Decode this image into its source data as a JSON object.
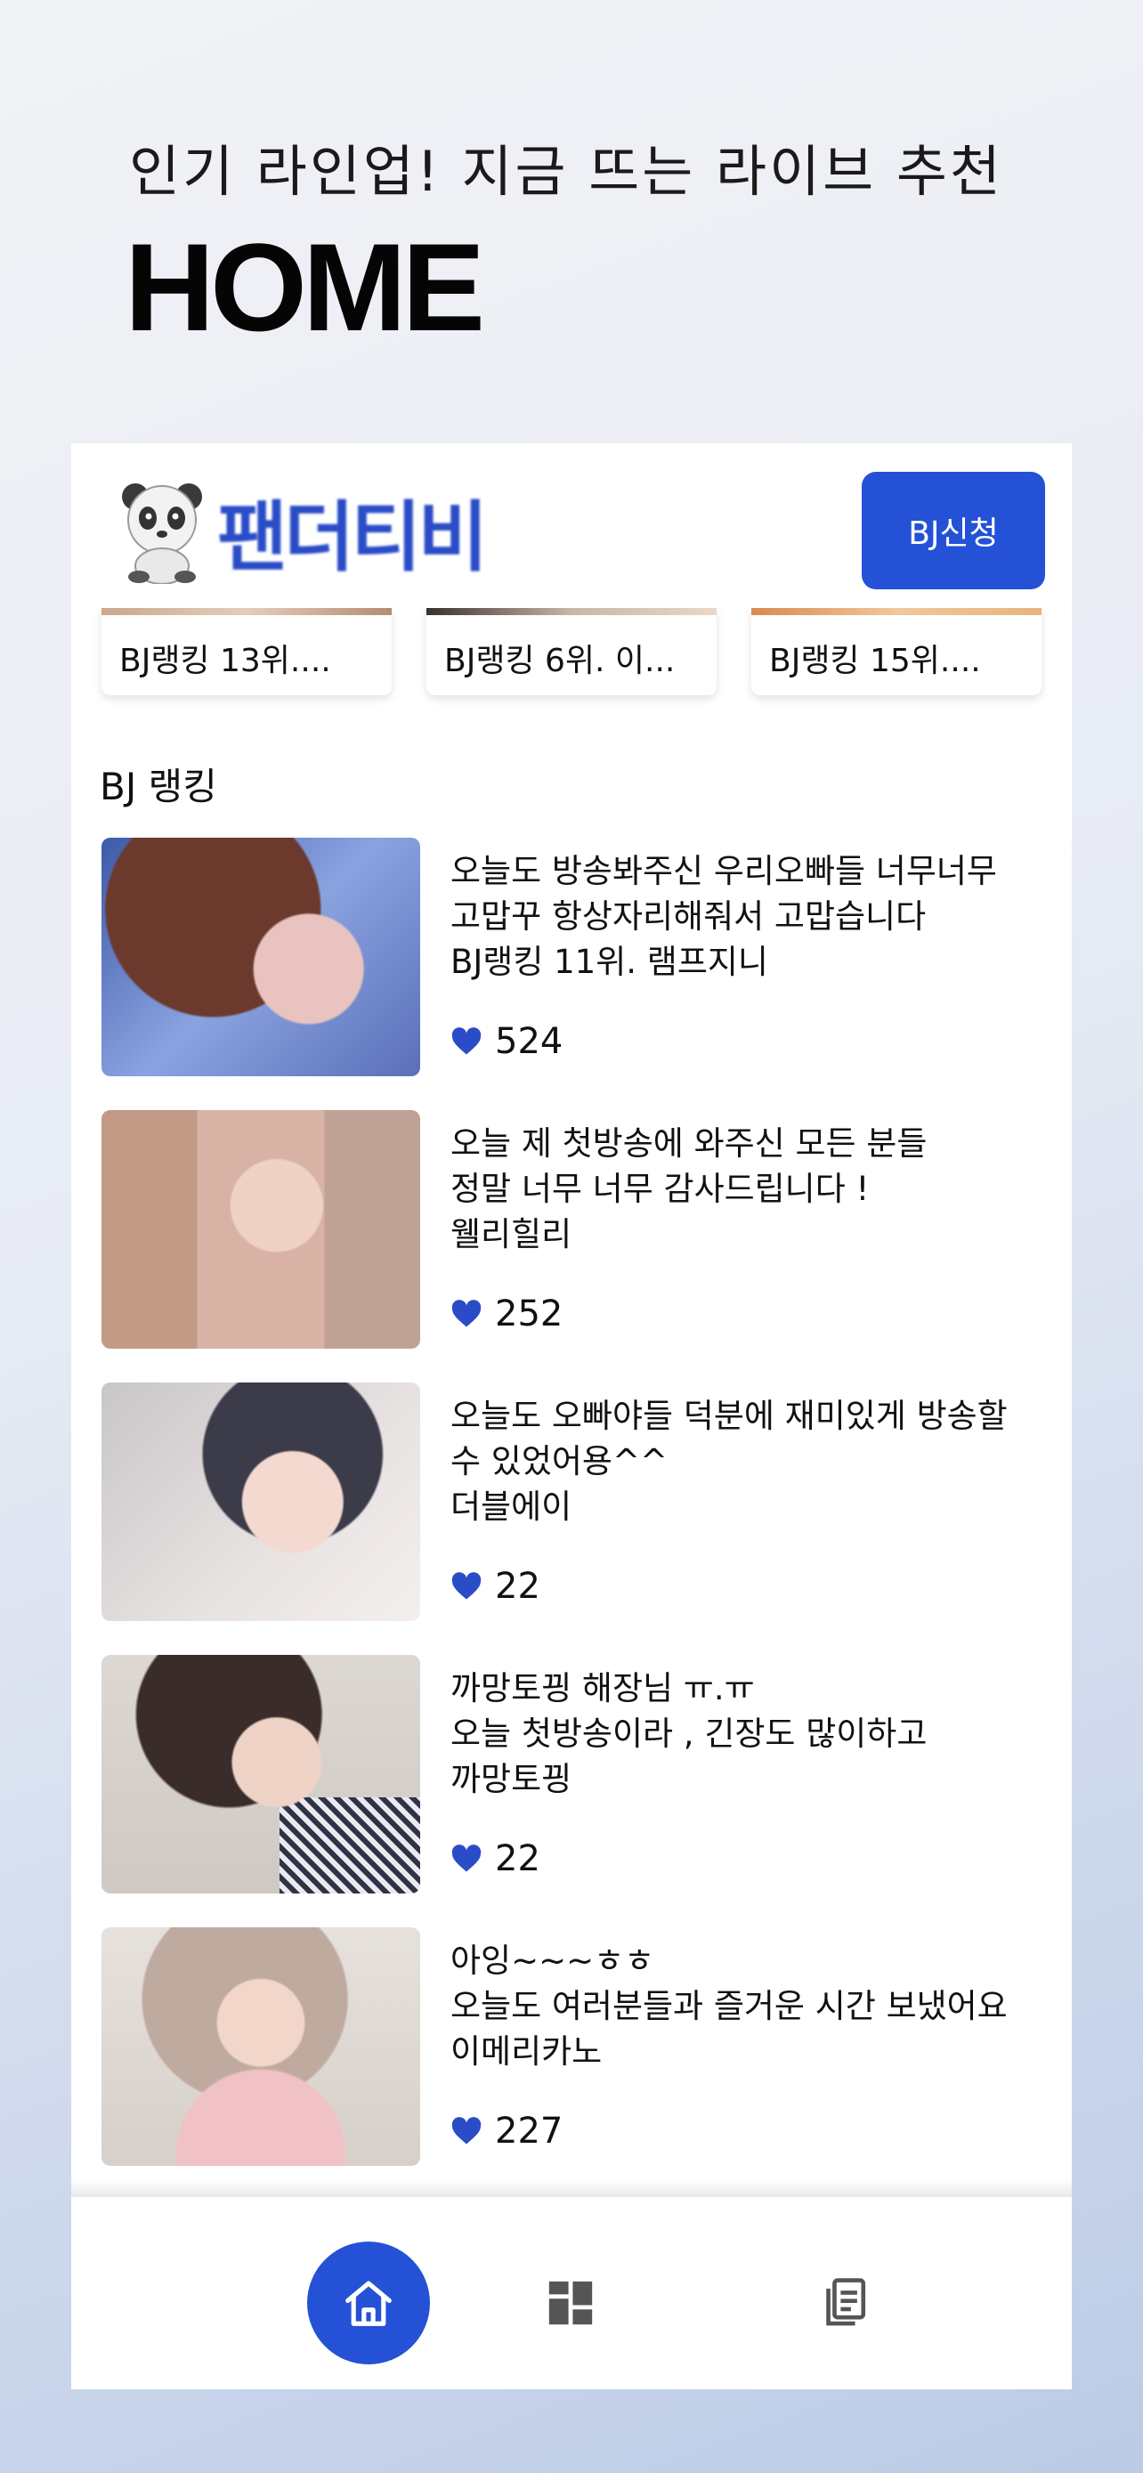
{
  "headline": {
    "subtitle": "인기 라인업! 지금 뜨는 라이브 추천",
    "title": "HOME"
  },
  "app": {
    "logo_text": "팬더티비",
    "apply_button": "BJ신청"
  },
  "carousel": [
    {
      "label": "BJ랭킹 13위...."
    },
    {
      "label": "BJ랭킹 6위. 이..."
    },
    {
      "label": "BJ랭킹 15위...."
    }
  ],
  "ranking": {
    "title": "BJ 랭킹",
    "items": [
      {
        "line1": "오늘도 방송봐주신 우리오빠들 너무너무",
        "line2": "고맙꾸 항상자리해줘서 고맙습니다",
        "name": "BJ랭킹 11위. 램프지니",
        "likes": "524"
      },
      {
        "line1": "오늘 제 첫방송에 와주신 모든 분들",
        "line2": "정말 너무 너무 감사드립니다 !",
        "name": "웰리힐리",
        "likes": "252"
      },
      {
        "line1": "오늘도 오빠야들 덕분에 재미있게 방송할",
        "line2": "수 있었어용^^",
        "name": "더블에이",
        "likes": "22"
      },
      {
        "line1": "까망토끵 해장님 ㅠ.ㅠ",
        "line2": "오늘 첫방송이라 , 긴장도 많이하고",
        "name": "까망토끵",
        "likes": "22"
      },
      {
        "line1": "아잉~~~ㅎㅎ",
        "line2": "오늘도 여러분들과 즐거운 시간 보냈어요",
        "name": "이메리카노",
        "likes": "227"
      }
    ]
  },
  "colors": {
    "accent": "#2451d6",
    "heart": "#2a4cc7"
  },
  "icons": {
    "home": "home-icon",
    "dashboard": "dashboard-icon",
    "documents": "documents-icon",
    "heart": "heart-icon"
  }
}
